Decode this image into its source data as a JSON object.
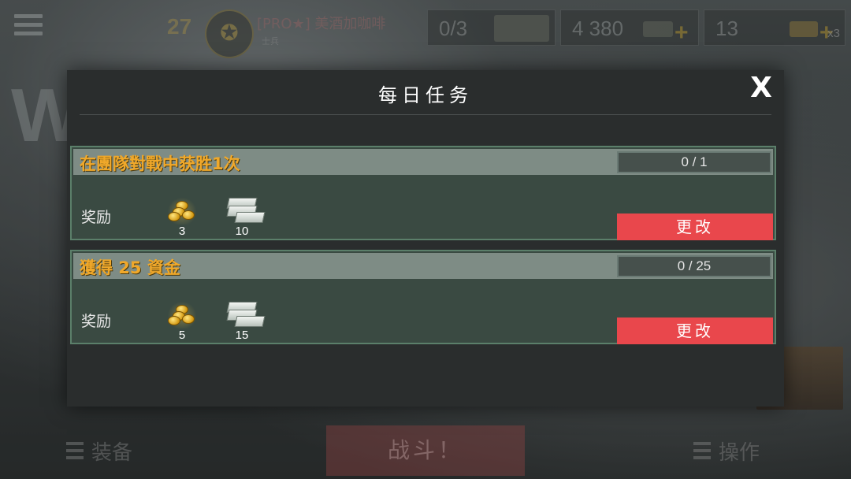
{
  "hud": {
    "level": "27",
    "rank_emblem": "✪",
    "player_name": "[PRO★] 美酒加咖啡",
    "player_rank": "士兵",
    "resources": [
      {
        "value": "0/3",
        "icon": "ammo-crate-icon"
      },
      {
        "value": "4 380",
        "icon": "cash-stack-icon"
      },
      {
        "value": "13",
        "icon": "gold-bar-icon",
        "multiplier": "x3"
      }
    ]
  },
  "modal": {
    "title": "每日任务",
    "close_label": "X",
    "tasks": [
      {
        "name": "在團隊對戰中获胜1次",
        "progress": "0 / 1",
        "reward_label": "奖励",
        "rewards": [
          {
            "icon": "gold-coins-icon",
            "qty": "3"
          },
          {
            "icon": "cash-stack-icon",
            "qty": "10"
          }
        ],
        "change_label": "更改"
      },
      {
        "name": "獲得 25 資金",
        "progress": "0 / 25",
        "reward_label": "奖励",
        "rewards": [
          {
            "icon": "gold-coins-icon",
            "qty": "5"
          },
          {
            "icon": "cash-stack-icon",
            "qty": "15"
          }
        ],
        "change_label": "更改"
      }
    ]
  },
  "bottom": {
    "equipment_label": "装备",
    "battle_label": "战斗！",
    "operations_label": "操作"
  },
  "colors": {
    "task_title": "#f0a82a",
    "change_button": "#e9474c",
    "task_border": "#5b7f6a"
  }
}
